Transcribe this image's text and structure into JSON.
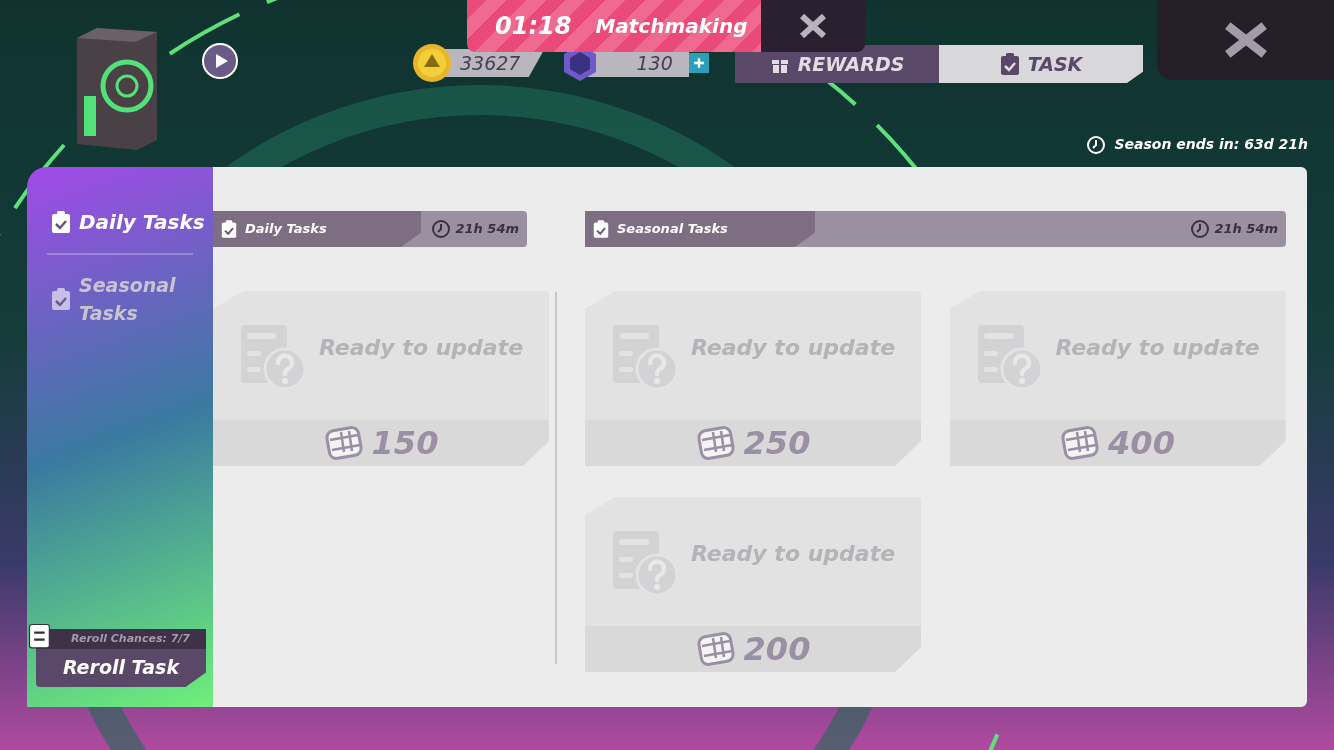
{
  "hud": {
    "timer": "01:18",
    "matchmaking": "Matchmaking",
    "coins": "33627",
    "gems": "130"
  },
  "tabs": [
    {
      "label": "REWARDS",
      "selected": false
    },
    {
      "label": "TASK",
      "selected": true
    }
  ],
  "season_ends": "Season ends in: 63d 21h",
  "sidebar": {
    "items": [
      {
        "label": "Daily Tasks",
        "selected": true
      },
      {
        "label": "Seasonal Tasks",
        "selected": false
      }
    ],
    "reroll": {
      "chances": "Reroll Chances: 7/7",
      "label": "Reroll Task"
    }
  },
  "daily": {
    "title": "Daily Tasks",
    "time": "21h 54m",
    "cards": [
      {
        "status": "Ready to update",
        "reward": "150"
      }
    ]
  },
  "seasonal": {
    "title": "Seasonal Tasks",
    "time": "21h 54m",
    "cards": [
      {
        "status": "Ready to update",
        "reward": "250"
      },
      {
        "status": "Ready to update",
        "reward": "400"
      },
      {
        "status": "Ready to update",
        "reward": "200"
      }
    ]
  }
}
